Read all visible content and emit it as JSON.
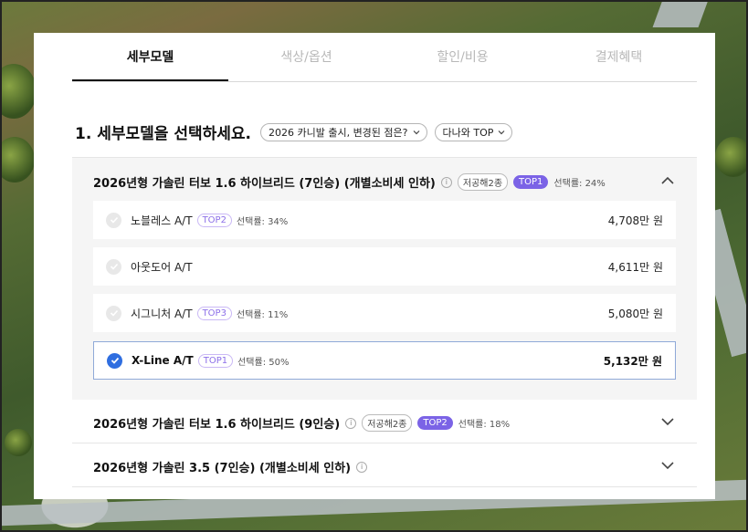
{
  "tabs": [
    "세부모델",
    "색상/옵션",
    "할인/비용",
    "결제혜택"
  ],
  "active_tab": "세부모델",
  "heading": "1. 세부모델을 선택하세요.",
  "filters": [
    "2026 카니발 출시, 변경된 점은?",
    "다나와 TOP"
  ],
  "groups": [
    {
      "title": "2026년형 가솔린 터보 1.6 하이브리드 (7인승) (개별소비세 인하)",
      "tag": "저공해2종",
      "top": "TOP1",
      "ratio": "선택률: 24%",
      "expanded": true,
      "options": [
        {
          "name": "노블레스 A/T",
          "top": "TOP2",
          "ratio": "선택률: 34%",
          "price": "4,708만 원",
          "selected": false
        },
        {
          "name": "아웃도어 A/T",
          "top": "",
          "ratio": "",
          "price": "4,611만 원",
          "selected": false
        },
        {
          "name": "시그니처 A/T",
          "top": "TOP3",
          "ratio": "선택률: 11%",
          "price": "5,080만 원",
          "selected": false
        },
        {
          "name": "X-Line A/T",
          "top": "TOP1",
          "ratio": "선택률: 50%",
          "price": "5,132만 원",
          "selected": true
        }
      ]
    },
    {
      "title": "2026년형 가솔린 터보 1.6 하이브리드 (9인승)",
      "tag": "저공해2종",
      "top": "TOP2",
      "ratio": "선택률: 18%",
      "expanded": false
    },
    {
      "title": "2026년형 가솔린 3.5 (7인승) (개별소비세 인하)",
      "tag": "",
      "top": "",
      "ratio": "",
      "expanded": false
    }
  ],
  "icons": {
    "info": "info-icon",
    "collapse": "chevron-up-icon",
    "expand": "chevron-down-icon",
    "check": "checkmark-icon",
    "filter_chevron": "chevron-down-icon"
  },
  "colors": {
    "accent_blue": "#2f6ee0",
    "top_purple": "#7b63e6",
    "selected_border": "#8fa9d8"
  }
}
